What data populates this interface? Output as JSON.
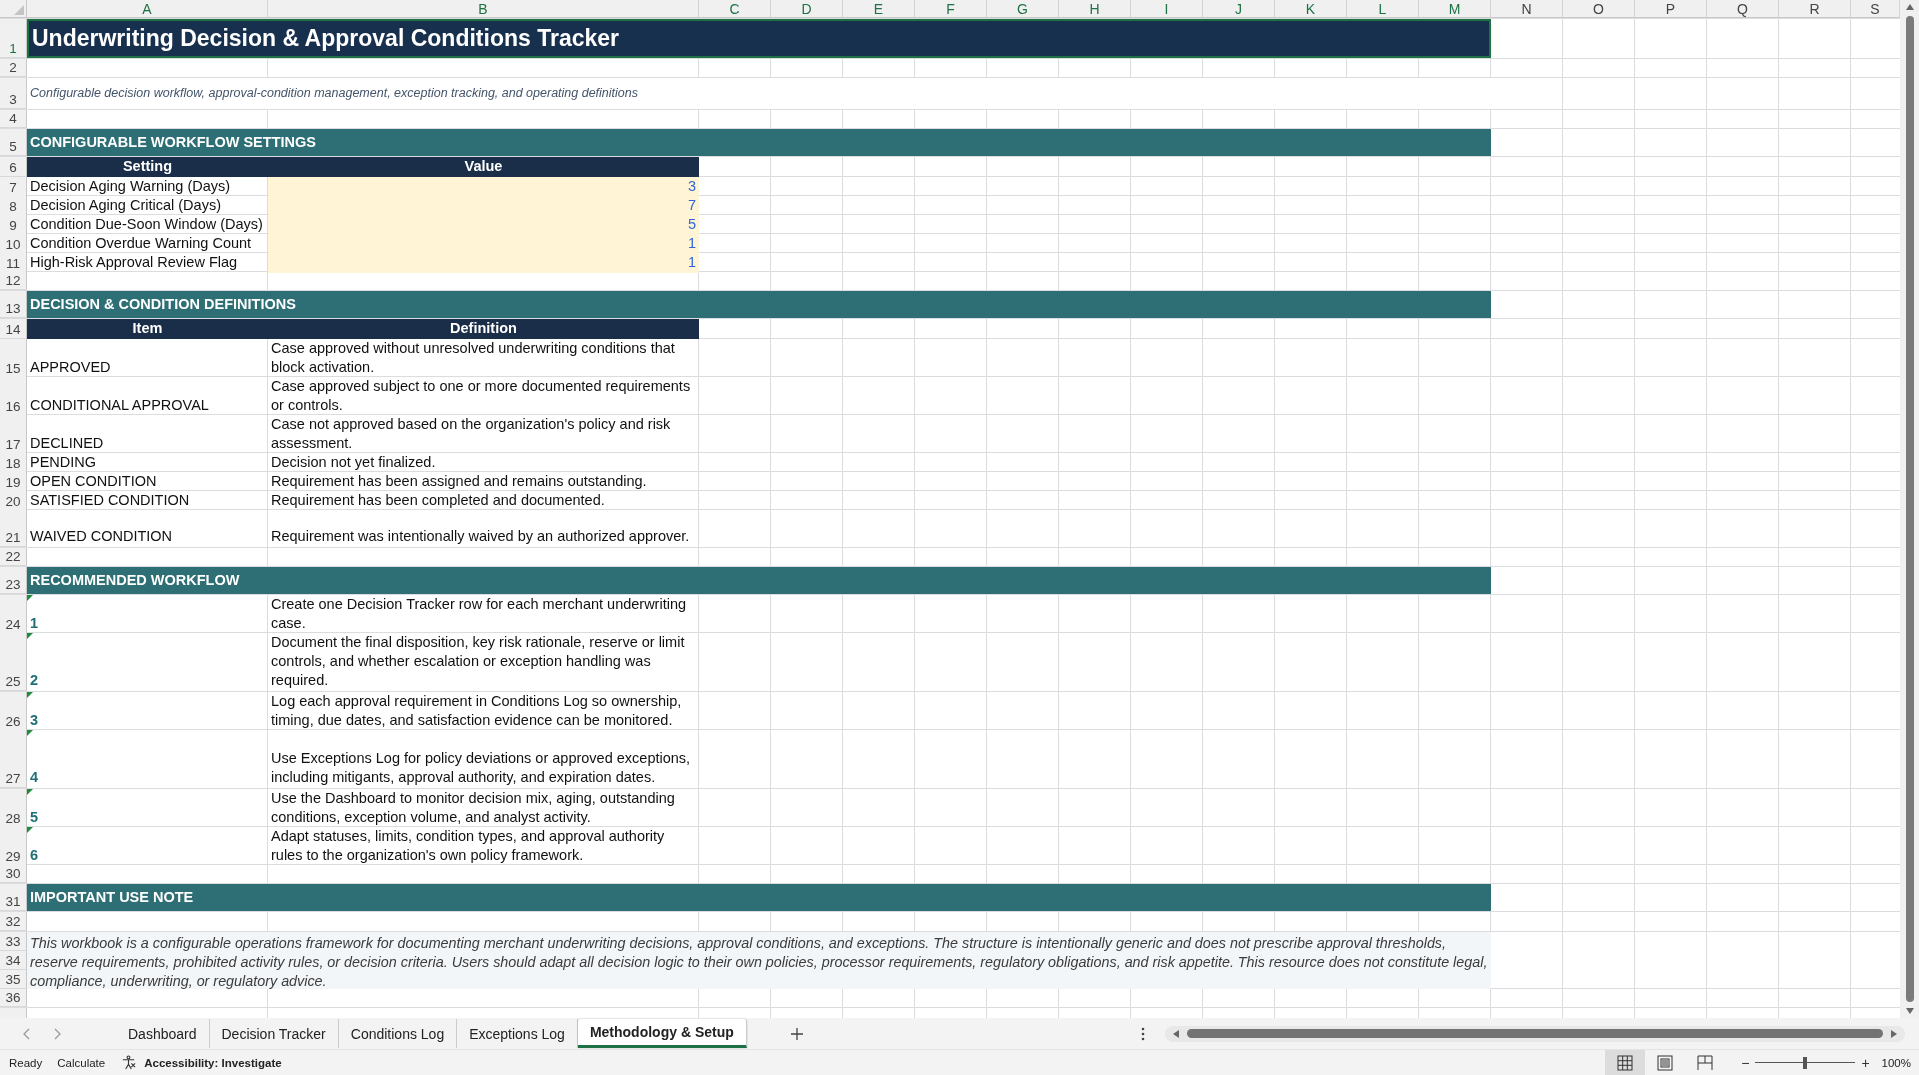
{
  "column_headers": [
    {
      "label": "A",
      "selected": true
    },
    {
      "label": "B",
      "selected": true
    },
    {
      "label": "C",
      "selected": true
    },
    {
      "label": "D",
      "selected": true
    },
    {
      "label": "E",
      "selected": true
    },
    {
      "label": "F",
      "selected": true
    },
    {
      "label": "G",
      "selected": true
    },
    {
      "label": "H",
      "selected": true
    },
    {
      "label": "I",
      "selected": true
    },
    {
      "label": "J",
      "selected": true
    },
    {
      "label": "K",
      "selected": true
    },
    {
      "label": "L",
      "selected": true
    },
    {
      "label": "M",
      "selected": true
    },
    {
      "label": "N",
      "selected": false
    },
    {
      "label": "O",
      "selected": false
    },
    {
      "label": "P",
      "selected": false
    },
    {
      "label": "Q",
      "selected": false
    },
    {
      "label": "R",
      "selected": false
    },
    {
      "label": "S",
      "selected": false
    }
  ],
  "row_headers": [
    {
      "label": "1",
      "selected": true
    },
    {
      "label": "2",
      "selected": false
    },
    {
      "label": "3",
      "selected": false
    },
    {
      "label": "4",
      "selected": false
    },
    {
      "label": "5",
      "selected": false
    },
    {
      "label": "6",
      "selected": false
    },
    {
      "label": "7",
      "selected": false
    },
    {
      "label": "8",
      "selected": false
    },
    {
      "label": "9",
      "selected": false
    },
    {
      "label": "10",
      "selected": false
    },
    {
      "label": "11",
      "selected": false
    },
    {
      "label": "12",
      "selected": false
    },
    {
      "label": "13",
      "selected": false
    },
    {
      "label": "14",
      "selected": false
    },
    {
      "label": "15",
      "selected": false
    },
    {
      "label": "16",
      "selected": false
    },
    {
      "label": "17",
      "selected": false
    },
    {
      "label": "18",
      "selected": false
    },
    {
      "label": "19",
      "selected": false
    },
    {
      "label": "20",
      "selected": false
    },
    {
      "label": "21",
      "selected": false
    },
    {
      "label": "22",
      "selected": false
    },
    {
      "label": "23",
      "selected": false
    },
    {
      "label": "24",
      "selected": false
    },
    {
      "label": "25",
      "selected": false
    },
    {
      "label": "26",
      "selected": false
    },
    {
      "label": "27",
      "selected": false
    },
    {
      "label": "28",
      "selected": false
    },
    {
      "label": "29",
      "selected": false
    },
    {
      "label": "30",
      "selected": false
    },
    {
      "label": "31",
      "selected": false
    },
    {
      "label": "32",
      "selected": false
    },
    {
      "label": "33",
      "selected": false
    },
    {
      "label": "34",
      "selected": false
    },
    {
      "label": "35",
      "selected": false
    },
    {
      "label": "36",
      "selected": false
    }
  ],
  "title": "Underwriting Decision & Approval Conditions Tracker",
  "subtitle": "Configurable decision workflow, approval-condition management, exception tracking, and operating definitions",
  "sections": [
    {
      "kind": "settings",
      "title": "CONFIGURABLE WORKFLOW SETTINGS",
      "columns": [
        "Setting",
        "Value"
      ],
      "rows": [
        {
          "label": "Decision Aging Warning (Days)",
          "value": "3"
        },
        {
          "label": "Decision Aging Critical (Days)",
          "value": "7"
        },
        {
          "label": "Condition Due-Soon Window (Days)",
          "value": "5"
        },
        {
          "label": "Condition Overdue Warning Count",
          "value": "1"
        },
        {
          "label": "High-Risk Approval Review Flag",
          "value": "1"
        }
      ]
    },
    {
      "kind": "definitions",
      "title": "DECISION & CONDITION DEFINITIONS",
      "columns": [
        "Item",
        "Definition"
      ],
      "rows": [
        {
          "item": "APPROVED",
          "definition": "Case approved without unresolved underwriting conditions that block activation."
        },
        {
          "item": "CONDITIONAL APPROVAL",
          "definition": "Case approved subject to one or more documented requirements or controls."
        },
        {
          "item": "DECLINED",
          "definition": "Case not approved based on the organization's policy and risk assessment."
        },
        {
          "item": "PENDING",
          "definition": "Decision not yet finalized."
        },
        {
          "item": "OPEN CONDITION",
          "definition": "Requirement has been assigned and remains outstanding."
        },
        {
          "item": "SATISFIED CONDITION",
          "definition": "Requirement has been completed and documented."
        },
        {
          "item": "WAIVED CONDITION",
          "definition": "Requirement was intentionally waived by an authorized approver."
        }
      ]
    },
    {
      "kind": "workflow",
      "title": "RECOMMENDED WORKFLOW",
      "steps": [
        {
          "number": "1",
          "text": "Create one Decision Tracker row for each merchant underwriting case."
        },
        {
          "number": "2",
          "text": "Document the final disposition, key risk rationale, reserve or limit controls, and whether escalation or exception handling was required."
        },
        {
          "number": "3",
          "text": "Log each approval requirement in Conditions Log so ownership, timing, due dates, and satisfaction evidence can be monitored."
        },
        {
          "number": "4",
          "text": "Use Exceptions Log for policy deviations or approved exceptions, including mitigants, approval authority, and expiration dates."
        },
        {
          "number": "5",
          "text": "Use the Dashboard to monitor decision mix, aging, outstanding conditions, exception volume, and analyst activity."
        },
        {
          "number": "6",
          "text": "Adapt statuses, limits, condition types, and approval authority rules to the organization's own policy framework."
        }
      ]
    },
    {
      "kind": "note",
      "title": "IMPORTANT USE NOTE",
      "text": "This workbook is a configurable operations framework for documenting merchant underwriting decisions, approval conditions, and exceptions. The structure is intentionally generic and does not prescribe approval thresholds, reserve requirements, prohibited activity rules, or decision criteria. Users should adapt all decision logic to their own policies, processor requirements, regulatory obligations, and risk appetite. This resource does not constitute legal, compliance, underwriting, or regulatory advice."
    }
  ],
  "sheet_tabs": [
    {
      "label": "Dashboard",
      "selected": false
    },
    {
      "label": "Decision Tracker",
      "selected": false
    },
    {
      "label": "Conditions Log",
      "selected": false
    },
    {
      "label": "Exceptions Log",
      "selected": false
    },
    {
      "label": "Methodology & Setup",
      "selected": true
    }
  ],
  "status_bar": {
    "items": [
      "Ready",
      "Calculate"
    ],
    "accessibility": "Accessibility: Investigate",
    "views": [
      {
        "kind": "normal",
        "selected": true
      },
      {
        "kind": "page_layout",
        "selected": false
      },
      {
        "kind": "page_break",
        "selected": false
      }
    ],
    "zoom_out": "−",
    "zoom_slider": {
      "level": 0.5
    },
    "zoom_in": "+",
    "zoom": "100%"
  }
}
